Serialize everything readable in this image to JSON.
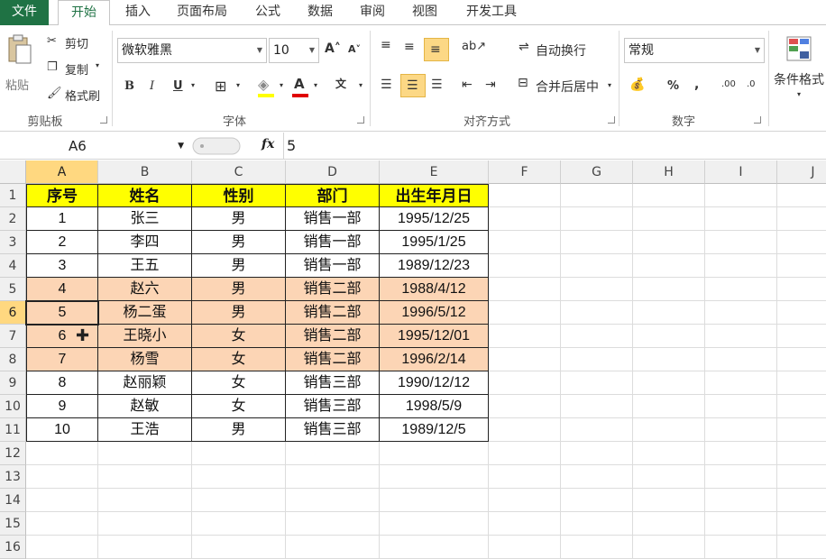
{
  "tabs": [
    "文件",
    "开始",
    "插入",
    "页面布局",
    "公式",
    "数据",
    "审阅",
    "视图",
    "开发工具"
  ],
  "clipboard": {
    "paste": "粘贴",
    "cut": "剪切",
    "copy": "复制",
    "format_painter": "格式刷",
    "group": "剪贴板"
  },
  "font": {
    "name": "微软雅黑",
    "size": "10",
    "bold": "B",
    "italic": "I",
    "underline": "U",
    "group": "字体"
  },
  "alignment": {
    "wrap": "自动换行",
    "merge": "合并后居中",
    "group": "对齐方式"
  },
  "number": {
    "format": "常规",
    "percent": "%",
    "comma": ",",
    "group": "数字"
  },
  "styles": {
    "conditional": "条件格式"
  },
  "formula_bar": {
    "name_box": "A6",
    "fx": "fx",
    "value": "5"
  },
  "columns": [
    "A",
    "B",
    "C",
    "D",
    "E",
    "F",
    "G",
    "H",
    "I",
    "J"
  ],
  "rows": [
    "1",
    "2",
    "3",
    "4",
    "5",
    "6",
    "7",
    "8",
    "9",
    "10",
    "11",
    "12",
    "13",
    "14",
    "15",
    "16"
  ],
  "table": {
    "header": [
      "序号",
      "姓名",
      "性别",
      "部门",
      "出生年月日"
    ],
    "rows": [
      [
        "1",
        "张三",
        "男",
        "销售一部",
        "1995/12/25"
      ],
      [
        "2",
        "李四",
        "男",
        "销售一部",
        "1995/1/25"
      ],
      [
        "3",
        "王五",
        "男",
        "销售一部",
        "1989/12/23"
      ],
      [
        "4",
        "赵六",
        "男",
        "销售二部",
        "1988/4/12"
      ],
      [
        "5",
        "杨二蛋",
        "男",
        "销售二部",
        "1996/5/12"
      ],
      [
        "6",
        "王晓小",
        "女",
        "销售二部",
        "1995/12/01"
      ],
      [
        "7",
        "杨雪",
        "女",
        "销售二部",
        "1996/2/14"
      ],
      [
        "8",
        "赵丽颖",
        "女",
        "销售三部",
        "1990/12/12"
      ],
      [
        "9",
        "赵敏",
        "女",
        "销售三部",
        "1998/5/9"
      ],
      [
        "10",
        "王浩",
        "男",
        "销售三部",
        "1989/12/5"
      ]
    ]
  },
  "highlight_color": "#fcd5b5",
  "header_color": "#ffff00",
  "accent_color": "#1f7244"
}
